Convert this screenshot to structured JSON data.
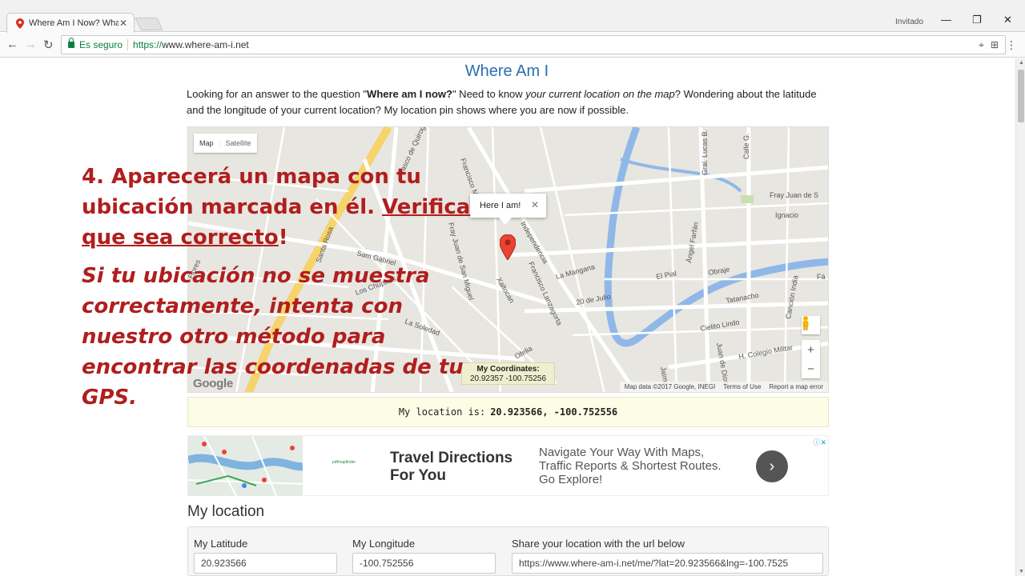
{
  "browser": {
    "tab_title": "Where Am I Now? What",
    "profile_label": "Invitado",
    "secure_label": "Es seguro",
    "url_proto": "https://",
    "url_host": "www.where-am-i.net"
  },
  "page": {
    "title": "Where Am I",
    "intro": {
      "p1": "Looking for an answer to the question \"",
      "q_bold": "Where am I now?",
      "p2": "\" Need to know ",
      "italic": "your current location on the map",
      "p3": "? Wondering about the latitude and the longitude of your current location? My location pin shows where you are now if possible."
    }
  },
  "map": {
    "type_map": "Map",
    "type_satellite": "Satellite",
    "popup_text": "Here I am!",
    "coords_label": "My Coordinates:",
    "coords_value": "20.92357 -100.75256",
    "footer_data": "Map data ©2017 Google, INEGI",
    "footer_terms": "Terms of Use",
    "footer_report": "Report a map error",
    "google_logo": "Google",
    "street_labels": [
      "Vasco de Quiroga",
      "Francisco Ma.",
      "Gral. Lucas B.",
      "Calle G.",
      "Fray Juan de S",
      "Ignacio",
      "Independencia",
      "Fray Juan de San Miguel",
      "Francisco Lanzagorta",
      "Xaltocan",
      "La Mangana",
      "El Pial",
      "Obraje",
      "Fá",
      "Tatanacho",
      "20 de Julio",
      "Cielito Lindo",
      "H. Colegio Militar",
      "La Soledad",
      "Ofelia",
      "Jaime",
      "Juan de Dios",
      "Ángel Farfán",
      "Canción India",
      "Sam Gabriel",
      "Los Chupiros",
      "Flores",
      "Santa Rosa"
    ]
  },
  "location_bar": {
    "label": "My location is:",
    "value": "20.923566, -100.752556"
  },
  "ad": {
    "title": "Travel Directions For You",
    "text": "Navigate Your Way With Maps, Traffic Reports & Shortest Routes. Go Explore!",
    "logo_text": "pdfmapfinder"
  },
  "my_location": {
    "title": "My location",
    "lat_label": "My Latitude",
    "lat_value": "20.923566",
    "lng_label": "My Longitude",
    "lng_value": "-100.752556",
    "share_label": "Share your location with the url below",
    "share_value": "https://www.where-am-i.net/me/?lat=20.923566&lng=-100.7525"
  },
  "annotation": {
    "line1": "4. Aparecerá un mapa con tu",
    "line2a": "ubicación marcada en él. ",
    "line2b": "Verifica",
    "line3a": "que sea correcto",
    "line3b": "!",
    "italic1": "Si tu ubicación no se muestra",
    "italic2": "correctamente, intenta con",
    "italic3": "nuestro otro método para",
    "italic4": "encontrar las coordenadas de tu",
    "italic5": "GPS."
  },
  "colors": {
    "annotation": "#b01e1e",
    "title_link": "#2a6fb0",
    "secure_green": "#0b8043"
  }
}
